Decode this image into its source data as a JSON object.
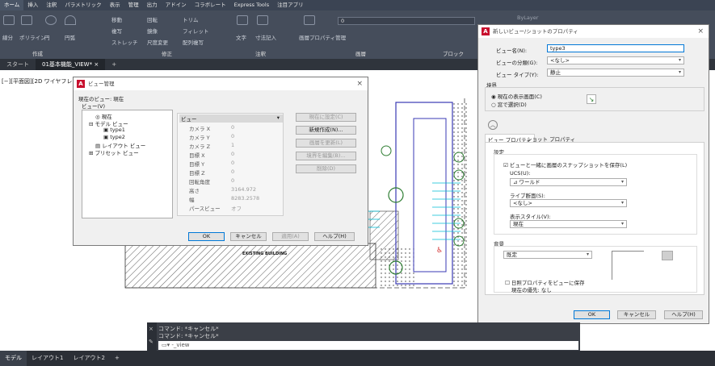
{
  "menu": {
    "items": [
      "ホーム",
      "挿入",
      "注釈",
      "パラメトリック",
      "表示",
      "管理",
      "出力",
      "アドイン",
      "コラボレート",
      "Express Tools",
      "注目アプリ"
    ]
  },
  "ribbon": {
    "tools": [
      "移動",
      "回転",
      "トリム",
      "複写",
      "鏡像",
      "フィレット",
      "ストレッチ",
      "尺度変更",
      "配列複写",
      "線分",
      "ポリライン",
      "円",
      "円弧",
      "文字",
      "寸法記入",
      "画層プロパティ管理"
    ],
    "groups": {
      "draw": "作成",
      "modify": "修正",
      "annotate": "注釈",
      "layers": "画層",
      "block": "ブロック"
    },
    "layer_name": "0",
    "bylayer": "ByLayer"
  },
  "doc_tabs": {
    "start": "スタート",
    "active": "01基本機能_VIEW*"
  },
  "viewport_label": "[−][平面図][2D ワイヤフレーム]",
  "view_manager": {
    "title": "ビュー管理",
    "current_view": "現在のビュー: 現在",
    "views_label": "ビュー(V)",
    "tree": [
      "現在",
      "モデル ビュー",
      "type1",
      "type2",
      "レイアウト ビュー",
      "プリセット ビュー"
    ],
    "props_header": "ビュー",
    "props": [
      {
        "k": "カメラ X",
        "v": "0"
      },
      {
        "k": "カメラ Y",
        "v": "0"
      },
      {
        "k": "カメラ Z",
        "v": "1"
      },
      {
        "k": "目標 X",
        "v": "0"
      },
      {
        "k": "目標 Y",
        "v": "0"
      },
      {
        "k": "目標 Z",
        "v": "0"
      },
      {
        "k": "回転角度",
        "v": "0"
      },
      {
        "k": "高さ",
        "v": "3164.972"
      },
      {
        "k": "幅",
        "v": "8283.2578"
      },
      {
        "k": "パースビュー",
        "v": "オフ"
      }
    ],
    "buttons": {
      "set_current": "現在に設定(C)",
      "new": "新規作成(N)...",
      "update_layers": "画層を更新(L)",
      "edit_boundary": "境界を編集(B)...",
      "delete": "削除(D)"
    },
    "footer": {
      "ok": "OK",
      "cancel": "キャンセル",
      "apply": "適用(A)",
      "help": "ヘルプ(H)"
    }
  },
  "new_view": {
    "title": "新しいビュー/ショットのプロパティ",
    "name_label": "ビュー名(N):",
    "name_value": "type3",
    "category_label": "ビューの分類(G):",
    "category_value": "<なし>",
    "type_label": "ビュー タイプ(Y):",
    "type_value": "静止",
    "boundary_title": "境界",
    "radio_current": "現在の表示画面(C)",
    "radio_window": "窓で選択(D)",
    "tab_view": "ビュー プロパティ",
    "tab_shot": "ショット プロパティ",
    "settings_title": "設定",
    "chk_snapshot": "ビューと一緒に画層のスナップショットを保存(L)",
    "ucs_label": "UCS(U):",
    "ucs_value": "ワールド",
    "section_label": "ライブ断面(S):",
    "section_value": "<なし>",
    "style_label": "表示スタイル(V):",
    "style_value": "現在",
    "background_title": "背景",
    "background_value": "既定",
    "chk_sun": "日照プロパティをビューに保存",
    "sun_override": "現在の優先: なし",
    "ok": "OK",
    "cancel": "キャンセル",
    "help": "ヘルプ(H)"
  },
  "drawing": {
    "label": "EXISTING BUILDING"
  },
  "command": {
    "line1": "コマンド: *キャンセル*",
    "line2": "コマンド: *キャンセル*",
    "prompt": "-_view"
  },
  "status_tabs": [
    "モデル",
    "レイアウト1",
    "レイアウト2",
    "+"
  ]
}
